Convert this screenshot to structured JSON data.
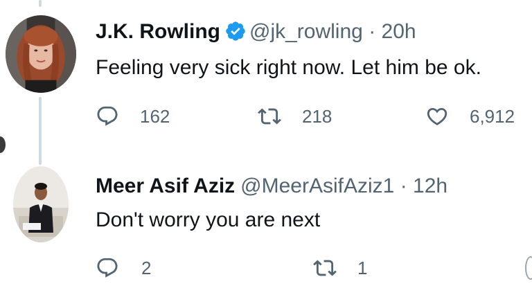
{
  "tweets": [
    {
      "display_name": "J.K. Rowling",
      "verified": true,
      "handle": "@jk_rowling",
      "separator": "·",
      "time": "20h",
      "text": "Feeling very sick right now. Let him be ok.",
      "replies": "162",
      "retweets": "218",
      "likes": "6,912"
    },
    {
      "display_name": "Meer Asif Aziz",
      "verified": false,
      "handle": "@MeerAsifAziz1",
      "separator": "·",
      "time": "12h",
      "text": "Don't worry you are next",
      "replies": "2",
      "retweets": "1"
    }
  ],
  "colors": {
    "text_primary": "#0f1419",
    "text_secondary": "#536471",
    "verified_badge": "#1d9bf0",
    "thread_line": "#cfd9de"
  },
  "icons": {
    "reply": "reply-icon",
    "retweet": "retweet-icon",
    "like": "like-icon",
    "verified": "verified-badge-icon"
  }
}
